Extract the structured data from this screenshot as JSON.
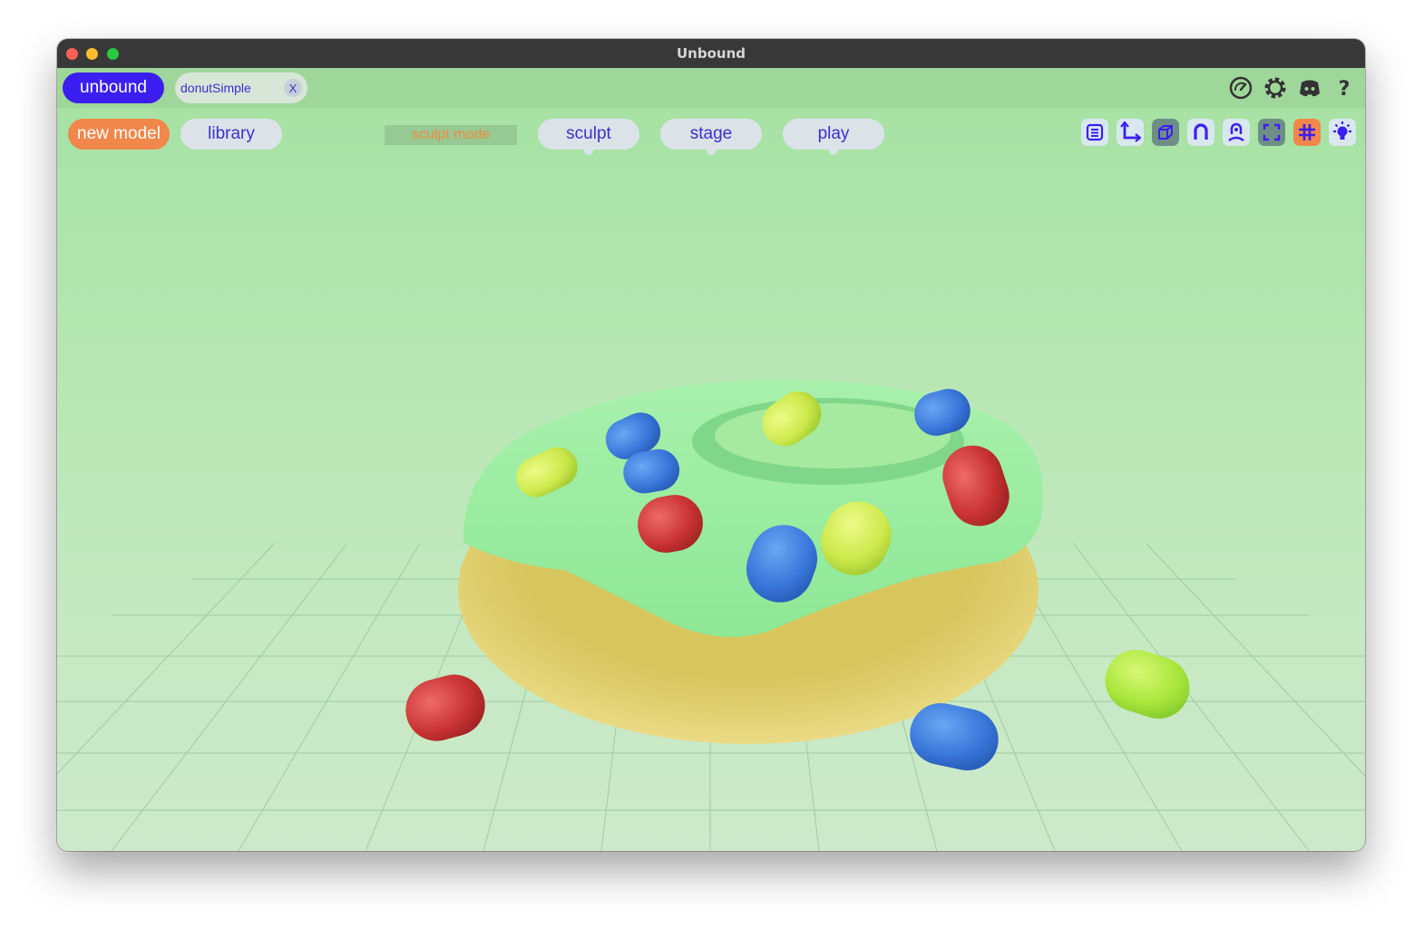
{
  "window": {
    "title": "Unbound"
  },
  "topbar": {
    "brand_label": "unbound",
    "open_file_tab": {
      "label": "donutSimple",
      "close_label": "X"
    },
    "icons": [
      "performance-gauge-icon",
      "settings-gear-icon",
      "discord-icon",
      "help-icon"
    ]
  },
  "toolbar": {
    "new_model_label": "new model",
    "library_label": "library",
    "mode_indicator": "sculpt mode",
    "modes": [
      "sculpt",
      "stage",
      "play"
    ],
    "view_tools": [
      "outliner-icon",
      "axes-icon",
      "cube-icon",
      "magnet-icon",
      "person-icon",
      "frame-icon",
      "grid-icon",
      "light-icon"
    ]
  },
  "colors": {
    "accent": "#3b1ff0",
    "new_model": "#f1874a",
    "background": "#b3e6b3",
    "frosting": "#98ee9a",
    "dough": "#e8d873",
    "sprinkle_red": "#d23a3a",
    "sprinkle_blue": "#3b7fe0",
    "sprinkle_yellow": "#d2ee4a"
  }
}
